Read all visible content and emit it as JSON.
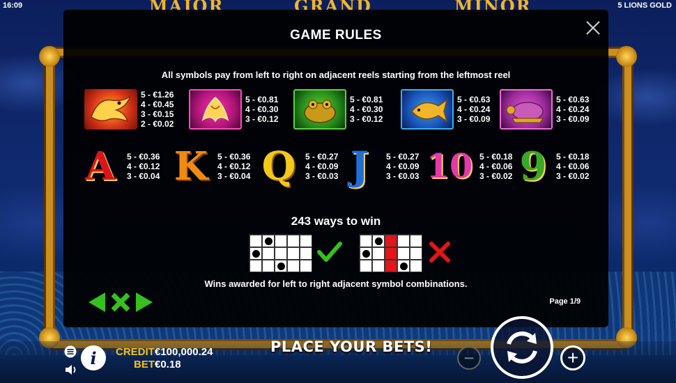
{
  "status_bar": {
    "time": "16:09",
    "game_title": "5 LIONS GOLD"
  },
  "jackpots": {
    "left": "MAJOR",
    "center": "GRAND",
    "right": "MINOR"
  },
  "rules_panel": {
    "title": "GAME RULES",
    "intro": "All symbols pay from left to right on adjacent reels starting from the leftmost reel",
    "symbols_row1": [
      {
        "icon": "dragon-symbol-icon",
        "pays": [
          "5 - €1.26",
          "4 - €0.45",
          "3 - €0.15",
          "2 - €0.02"
        ]
      },
      {
        "icon": "phoenix-symbol-icon",
        "pays": [
          "5 - €0.81",
          "4 - €0.30",
          "3 - €0.12"
        ]
      },
      {
        "icon": "frog-symbol-icon",
        "pays": [
          "5 - €0.81",
          "4 - €0.30",
          "3 - €0.12"
        ]
      },
      {
        "icon": "koi-fish-symbol-icon",
        "pays": [
          "5 - €0.63",
          "4 - €0.24",
          "3 - €0.09"
        ]
      },
      {
        "icon": "turtle-symbol-icon",
        "pays": [
          "5 - €0.63",
          "4 - €0.24",
          "3 - €0.09"
        ]
      }
    ],
    "symbols_row2": [
      {
        "letter": "A",
        "color": "#d8161c",
        "pays": [
          "5 - €0.36",
          "4 - €0.12",
          "3 - €0.04"
        ]
      },
      {
        "letter": "K",
        "color": "#f08a10",
        "pays": [
          "5 - €0.36",
          "4 - €0.12",
          "3 - €0.04"
        ]
      },
      {
        "letter": "Q",
        "color": "#f3c81a",
        "pays": [
          "5 - €0.27",
          "4 - €0.09",
          "3 - €0.03"
        ]
      },
      {
        "letter": "J",
        "color": "#1f6fd8",
        "pays": [
          "5 - €0.27",
          "4 - €0.09",
          "3 - €0.03"
        ]
      },
      {
        "letter": "10",
        "color": "#e23aa8",
        "pays": [
          "5 - €0.18",
          "4 - €0.06",
          "3 - €0.02"
        ]
      },
      {
        "letter": "9",
        "color": "#3aa82a",
        "pays": [
          "5 - €0.18",
          "4 - €0.06",
          "3 - €0.02"
        ]
      }
    ],
    "ways_title": "243 ways to win",
    "wins_note": "Wins awarded for left to right adjacent symbol combinations.",
    "page": "Page 1/9",
    "colors": {
      "valid": "#35c01e",
      "invalid": "#e3141b"
    }
  },
  "bottom_bar": {
    "credit_label": "CREDIT",
    "credit_value": "€100,000.24",
    "bet_label": "BET",
    "bet_value": "€0.18",
    "message": "PLACE YOUR BETS!",
    "minus": "−",
    "plus": "+"
  }
}
